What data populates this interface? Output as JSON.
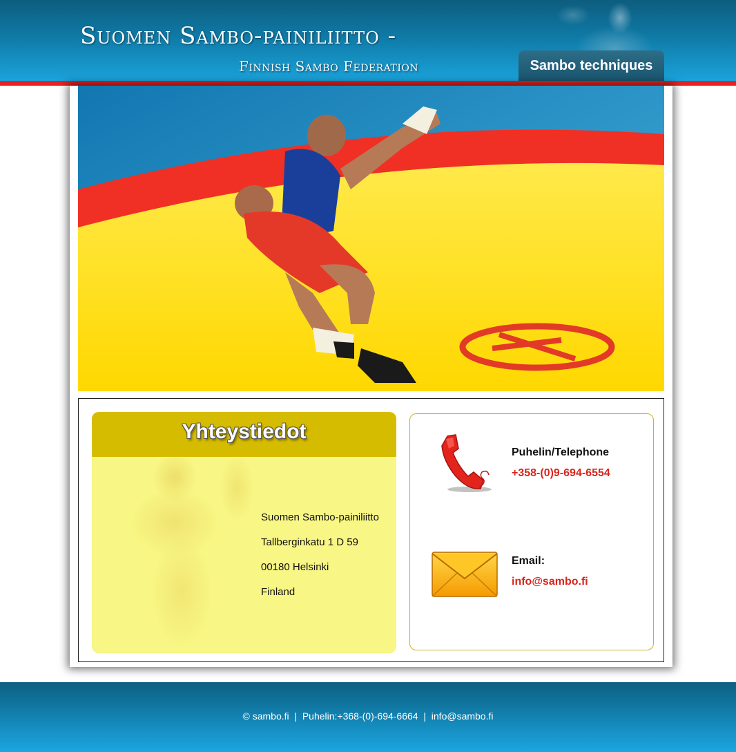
{
  "header": {
    "title": "Suomen Sambo-painiliitto -",
    "subtitle": "Finnish Sambo Federation",
    "techniques_button": "Sambo techniques"
  },
  "contact": {
    "heading": "Yhteystiedot",
    "address": [
      "Suomen Sambo-painiliitto",
      "Tallberginkatu 1 D 59",
      "00180 Helsinki",
      "Finland"
    ]
  },
  "phone": {
    "label": "Puhelin/Telephone",
    "number": "+358-(0)9-694-6554"
  },
  "email": {
    "label": "Email:",
    "address": "info@sambo.fi"
  },
  "footer": {
    "copyright": "© sambo.fi",
    "separator": "  |  ",
    "phone": "Puhelin:+368-(0)-694-6664",
    "email": "info@sambo.fi"
  },
  "colors": {
    "header_blue": "#0f7aa6",
    "accent_red": "#e8231f",
    "card_yellow": "#f8f684",
    "card_header_gold": "#d6bc00",
    "link_red": "#d9251d"
  },
  "icons": [
    "telephone-icon",
    "envelope-icon"
  ]
}
